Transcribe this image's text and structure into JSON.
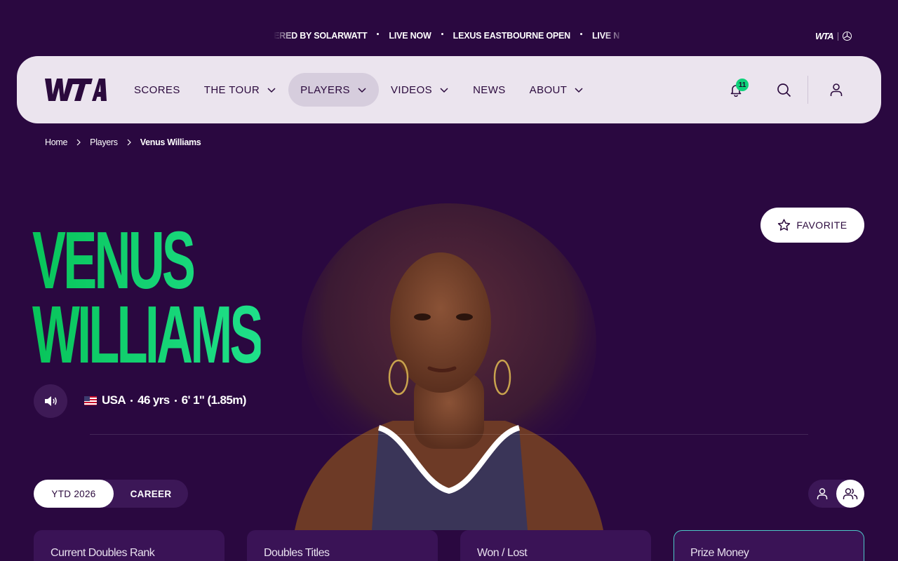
{
  "ticker": {
    "items": [
      "ERED BY SOLARWATT",
      "LIVE NOW",
      "LEXUS EASTBOURNE OPEN",
      "LIVE N"
    ]
  },
  "brand": {
    "logo_text": "WTA",
    "partner_icon": "mercedes-star-icon"
  },
  "nav": {
    "items": [
      {
        "label": "SCORES",
        "has_dropdown": false,
        "active": false
      },
      {
        "label": "THE TOUR",
        "has_dropdown": true,
        "active": false
      },
      {
        "label": "PLAYERS",
        "has_dropdown": true,
        "active": true
      },
      {
        "label": "VIDEOS",
        "has_dropdown": true,
        "active": false
      },
      {
        "label": "NEWS",
        "has_dropdown": false,
        "active": false
      },
      {
        "label": "ABOUT",
        "has_dropdown": true,
        "active": false
      }
    ],
    "notifications_count": "11",
    "icons": [
      "bell-icon",
      "search-icon",
      "user-icon"
    ]
  },
  "breadcrumb": [
    "Home",
    "Players",
    "Venus Williams"
  ],
  "player": {
    "first_name": "VENUS",
    "last_name": "WILLIAMS",
    "country": "USA",
    "age": "46 yrs",
    "height": "6' 1\" (1.85m)"
  },
  "favorite": {
    "label": "FAVORITE"
  },
  "period_toggle": {
    "options": [
      "YTD 2026",
      "CAREER"
    ],
    "selected": "YTD 2026"
  },
  "mode_toggle": {
    "options": [
      "singles-icon",
      "doubles-icon"
    ],
    "selected": "doubles-icon"
  },
  "stats": {
    "cards": [
      "Current Doubles Rank",
      "Doubles Titles",
      "Won / Lost",
      "Prize Money"
    ]
  },
  "colors": {
    "background": "#2a0840",
    "name_gradient_start": "#08c45a",
    "name_gradient_end": "#1fe08a",
    "navbar_bg": "#ebe4ee",
    "badge": "#0ed27a",
    "card_bg": "#3a1356",
    "card_highlight_border": "#4dc8c8"
  }
}
